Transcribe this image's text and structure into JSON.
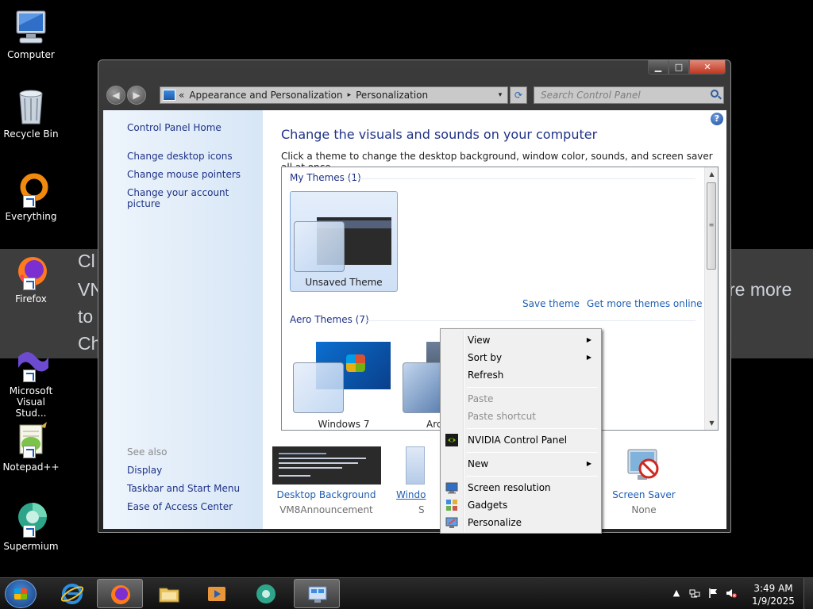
{
  "desktop": {
    "icons": [
      {
        "label": "Computer"
      },
      {
        "label": "Recycle Bin"
      },
      {
        "label": "Everything"
      },
      {
        "label": "Firefox"
      },
      {
        "label": "Microsoft Visual Stud..."
      },
      {
        "label": "Notepad++"
      },
      {
        "label": "Supermium"
      }
    ]
  },
  "banner": {
    "lines": [
      "Cl",
      "VN",
      "to",
      "Ch"
    ],
    "right_text": "re more"
  },
  "window": {
    "caption_buttons": {
      "minimize": "▁",
      "maximize": "□",
      "close": "✕"
    },
    "nav": {
      "back": "◀",
      "forward": "▶"
    },
    "address": {
      "chevron": "«",
      "crumbs": [
        "Appearance and Personalization",
        "Personalization"
      ],
      "separator": "▸",
      "dropdown": "▾",
      "refresh": "⟳"
    },
    "search": {
      "placeholder": "Search Control Panel"
    },
    "sidebar": {
      "home": "Control Panel Home",
      "links": [
        "Change desktop icons",
        "Change mouse pointers",
        "Change your account picture"
      ],
      "see_also": "See also",
      "see_also_links": [
        "Display",
        "Taskbar and Start Menu",
        "Ease of Access Center"
      ]
    },
    "main": {
      "help": "?",
      "title": "Change the visuals and sounds on your computer",
      "subtitle": "Click a theme to change the desktop background, window color, sounds, and screen saver all at once.",
      "my_themes_header": "My Themes (1)",
      "unsaved_theme": "Unsaved Theme",
      "save_theme": "Save theme",
      "get_more": "Get more themes online",
      "aero_header": "Aero Themes (7)",
      "aero_themes": [
        "Windows 7",
        "Arc"
      ],
      "scroll": {
        "up": "▲",
        "down": "▼",
        "grip": "≡"
      }
    },
    "bottom": {
      "desktop_background": {
        "label": "Desktop Background",
        "value": "VM8Announcement"
      },
      "window_color": {
        "label": "Windo",
        "value": "S"
      },
      "screen_saver": {
        "label": "Screen Saver",
        "value": "None"
      }
    }
  },
  "context_menu": {
    "items": [
      {
        "label": "View",
        "submenu": true
      },
      {
        "label": "Sort by",
        "submenu": true
      },
      {
        "label": "Refresh"
      },
      {
        "label": "Paste",
        "disabled": true
      },
      {
        "label": "Paste shortcut",
        "disabled": true
      },
      {
        "label": "NVIDIA Control Panel",
        "icon": "nvidia-icon"
      },
      {
        "label": "New",
        "submenu": true
      },
      {
        "label": "Screen resolution",
        "icon": "monitor-icon"
      },
      {
        "label": "Gadgets",
        "icon": "gadgets-icon"
      },
      {
        "label": "Personalize",
        "icon": "personalize-icon"
      }
    ],
    "submenu_arrow": "▶"
  },
  "taskbar": {
    "clock_time": "3:49 AM",
    "clock_date": "1/9/2025",
    "tray_expand": "▲"
  }
}
